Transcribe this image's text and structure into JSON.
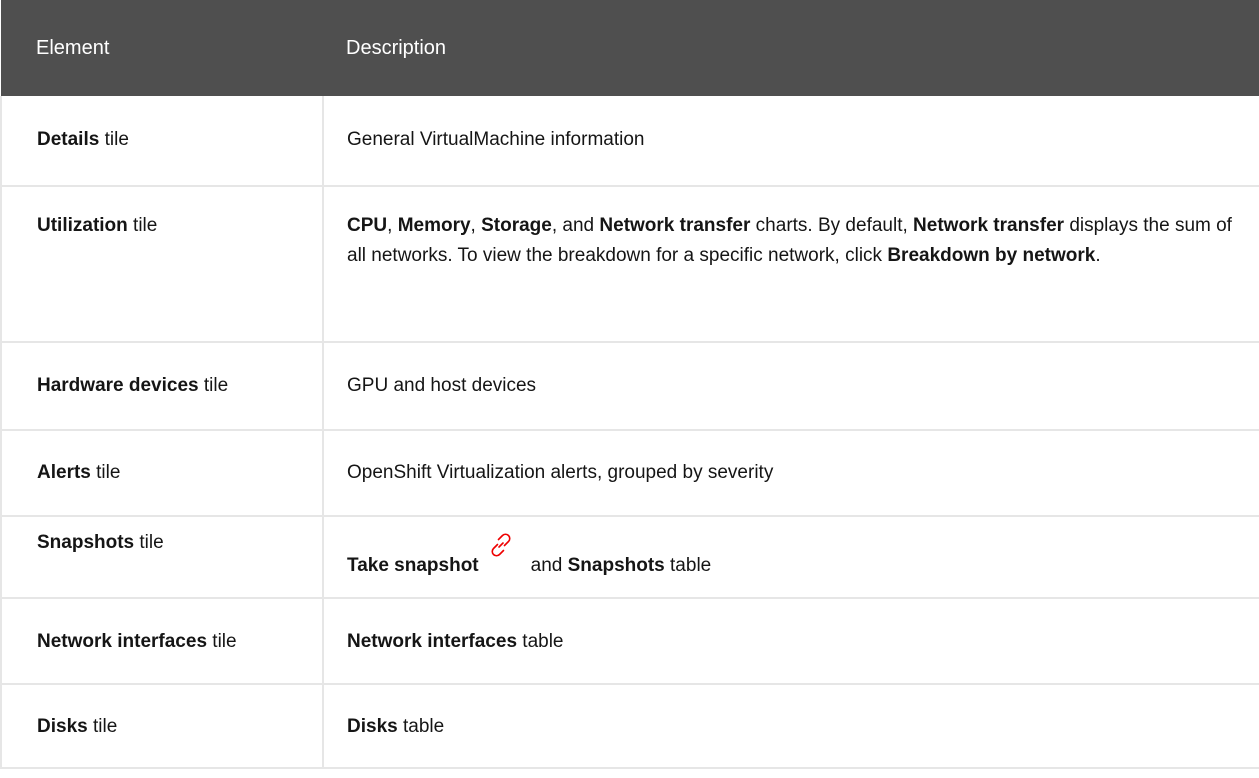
{
  "header": {
    "col1": "Element",
    "col2": "Description"
  },
  "rows": {
    "details": {
      "name": "Details",
      "suffix": " tile",
      "desc": "General VirtualMachine information"
    },
    "utilization": {
      "name": "Utilization",
      "suffix": " tile",
      "d1": "CPU",
      "d2": ", ",
      "d3": "Memory",
      "d4": ", ",
      "d5": "Storage",
      "d6": ", and ",
      "d7": "Network transfer",
      "d8": " charts. By default, ",
      "d9": "Network transfer",
      "d10": " displays the sum of all networks. To view the breakdown for a specific network, click ",
      "d11": "Breakdown by network",
      "d12": "."
    },
    "hardware": {
      "name": "Hardware devices",
      "suffix": " tile",
      "desc": "GPU and host devices"
    },
    "alerts": {
      "name": "Alerts",
      "suffix": " tile",
      "desc": "OpenShift Virtualization alerts, grouped by severity"
    },
    "snapshots": {
      "name": "Snapshots",
      "suffix": " tile",
      "d1": "Take snapshot",
      "d2": "and ",
      "d3": "Snapshots",
      "d4": " table",
      "icon": "link-icon",
      "icon_color": "#ee0000"
    },
    "network": {
      "name": "Network interfaces",
      "suffix": " tile",
      "d1": "Network interfaces",
      "d2": " table"
    },
    "disks": {
      "name": "Disks",
      "suffix": " tile",
      "d1": "Disks",
      "d2": " table"
    }
  },
  "colors": {
    "header_bg": "#4f4f4f",
    "border": "#e6e6e6",
    "icon": "#ee0000"
  }
}
